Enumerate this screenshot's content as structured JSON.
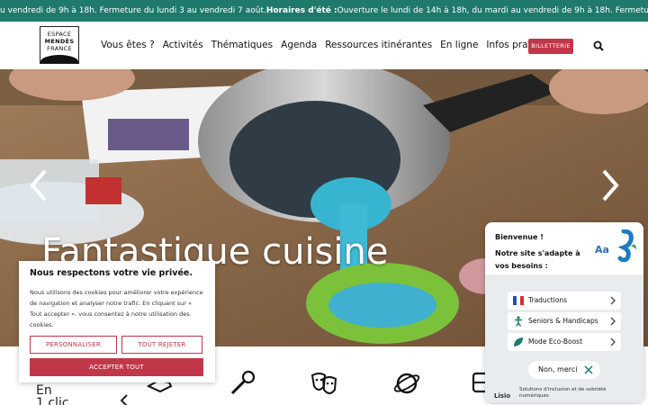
{
  "ticker": {
    "text_a": "u vendredi de 9h à 18h. Fermeture du lundi 3 au vendredi 7 août. ",
    "bold": "Horaires d'été :",
    "text_b": " Ouverture le lundi de 14h à 18h, du mardi au vendredi de 9h à 18h. Fermeture du lundi 3 au v"
  },
  "logo": {
    "line1": "ESPACE",
    "line2": "MENDÈS",
    "line3": "FRANCE"
  },
  "nav": [
    "Vous êtes ?",
    "Activités",
    "Thématiques",
    "Agenda",
    "Ressources itinérantes",
    "En ligne",
    "Infos pratiques"
  ],
  "billetterie": "BILLETTERIE",
  "hero": {
    "title": "Fantastique cuisine"
  },
  "bottom": {
    "en_line1": "En",
    "en_line2": "1 clic"
  },
  "cookie": {
    "title": "Nous respectons votre vie privée.",
    "text": "Nous utilisons des cookies pour améliorer votre expérience de navigation et analyser notre trafic. En cliquant sur « Tout accepter », vous consentez à notre utilisation des cookies.",
    "customize": "PERSONNALISER",
    "reject": "TOUT REJETER",
    "accept": "ACCEPTER TOUT"
  },
  "widget": {
    "hello": "Bienvenue !",
    "message": "Notre site s'adapte à vos besoins :",
    "aa": "Aa",
    "items": [
      {
        "label": "Traductions"
      },
      {
        "label": "Seniors & Handicaps"
      },
      {
        "label": "Mode Eco-Boost"
      }
    ],
    "no_thanks": "Non, merci",
    "brand": "Lisio",
    "footer": "Solutions d'inclusion et de sobriété numériques"
  },
  "colors": {
    "ticker_bg": "#1f7a6c",
    "accent": "#c0374a"
  }
}
